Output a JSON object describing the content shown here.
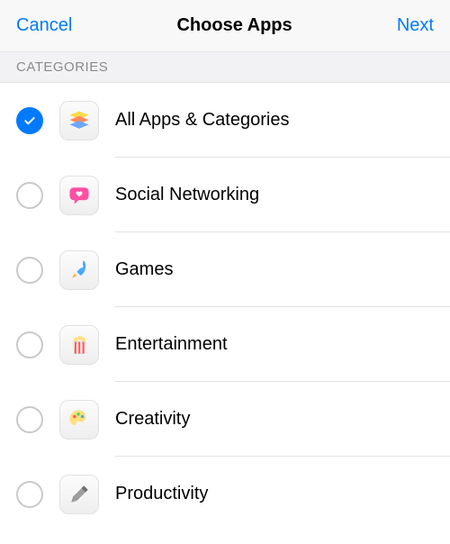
{
  "nav": {
    "cancel": "Cancel",
    "title": "Choose Apps",
    "next": "Next"
  },
  "section_header": "CATEGORIES",
  "categories": [
    {
      "icon": "stack-icon",
      "label": "All Apps & Categories",
      "selected": true
    },
    {
      "icon": "chat-heart-icon",
      "label": "Social Networking",
      "selected": false
    },
    {
      "icon": "rocket-icon",
      "label": "Games",
      "selected": false
    },
    {
      "icon": "popcorn-icon",
      "label": "Entertainment",
      "selected": false
    },
    {
      "icon": "palette-icon",
      "label": "Creativity",
      "selected": false
    },
    {
      "icon": "pen-icon",
      "label": "Productivity",
      "selected": false
    }
  ]
}
